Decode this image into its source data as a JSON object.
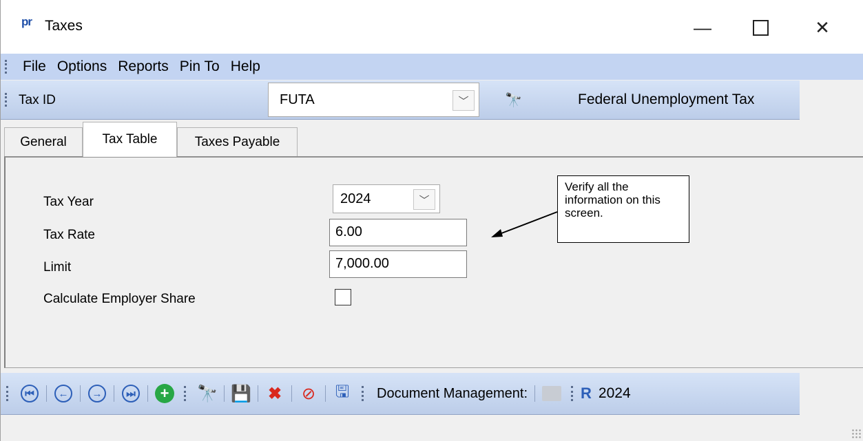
{
  "window": {
    "app_icon_text": "pr",
    "title": "Taxes",
    "minimize_glyph": "—",
    "close_glyph": "✕"
  },
  "menu": {
    "items": [
      "File",
      "Options",
      "Reports",
      "Pin To",
      "Help"
    ]
  },
  "tax_id_bar": {
    "label": "Tax ID",
    "value": "FUTA",
    "name": "Federal Unemployment Tax"
  },
  "tabs": [
    {
      "label": "General",
      "active": false
    },
    {
      "label": "Tax Table",
      "active": true
    },
    {
      "label": "Taxes Payable",
      "active": false
    }
  ],
  "form": {
    "tax_year_label": "Tax Year",
    "tax_year_value": "2024",
    "tax_rate_label": "Tax Rate",
    "tax_rate_value": "6.00",
    "limit_label": "Limit",
    "limit_value": "7,000.00",
    "employer_share_label": "Calculate Employer Share",
    "employer_share_checked": false
  },
  "callout": {
    "text": "Verify all the information on this screen."
  },
  "toolbar": {
    "document_management_label": "Document Management:",
    "year": "2024",
    "icons": [
      "first-record-icon",
      "previous-record-icon",
      "next-record-icon",
      "last-record-icon",
      "add-icon",
      "search-icon",
      "save-icon",
      "delete-icon",
      "cancel-icon",
      "save-new-icon",
      "folder-icon",
      "report-icon"
    ]
  },
  "colors": {
    "menu_bg": "#c3d4f2",
    "toolbar_bg": "#bccde9",
    "nav_blue": "#2d5fb8",
    "delete_red": "#d9281e",
    "add_green": "#28a745"
  }
}
